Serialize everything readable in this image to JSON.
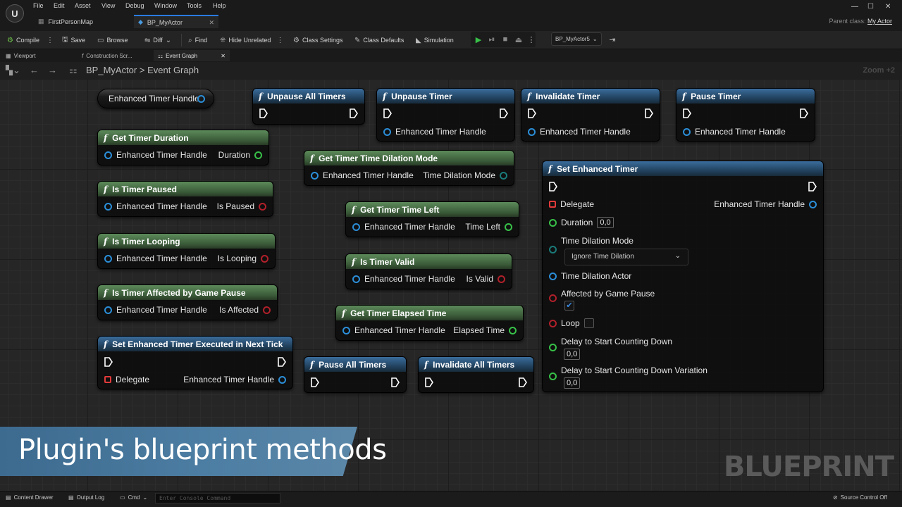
{
  "app": {
    "logo": "U",
    "menu": [
      "File",
      "Edit",
      "Asset",
      "View",
      "Debug",
      "Window",
      "Tools",
      "Help"
    ],
    "tabs": [
      {
        "label": "FirstPersonMap"
      },
      {
        "label": "BP_MyActor"
      }
    ],
    "window_controls": [
      "—",
      "☐",
      "✕"
    ],
    "parent_class_label": "Parent class:",
    "parent_class_value": "My Actor"
  },
  "toolbar": {
    "compile": "Compile",
    "save": "Save",
    "browse": "Browse",
    "diff": "Diff",
    "find": "Find",
    "hide_unrelated": "Hide Unrelated",
    "class_settings": "Class Settings",
    "class_defaults": "Class Defaults",
    "simulation": "Simulation",
    "debug_object": "BP_MyActor5"
  },
  "panel_tabs": [
    "Viewport",
    "Construction Scr...",
    "Event Graph"
  ],
  "breadcrumb": {
    "asset": "BP_MyActor",
    "separator": ">",
    "graph": "Event Graph"
  },
  "zoom": "Zoom +2",
  "nodes": {
    "var_handle": {
      "label": "Enhanced Timer Handle"
    },
    "unpause_all": {
      "title": "Unpause All Timers"
    },
    "unpause": {
      "title": "Unpause Timer",
      "in": "Enhanced Timer Handle"
    },
    "invalidate": {
      "title": "Invalidate Timer",
      "in": "Enhanced Timer Handle"
    },
    "pause": {
      "title": "Pause Timer",
      "in": "Enhanced Timer Handle"
    },
    "get_duration": {
      "title": "Get Timer Duration",
      "in": "Enhanced Timer Handle",
      "out": "Duration"
    },
    "get_dilation": {
      "title": "Get Timer Time Dilation Mode",
      "in": "Enhanced Timer Handle",
      "out": "Time Dilation Mode"
    },
    "is_paused": {
      "title": "Is Timer Paused",
      "in": "Enhanced Timer Handle",
      "out": "Is Paused"
    },
    "time_left": {
      "title": "Get Timer Time Left",
      "in": "Enhanced Timer Handle",
      "out": "Time Left"
    },
    "is_looping": {
      "title": "Is Timer Looping",
      "in": "Enhanced Timer Handle",
      "out": "Is Looping"
    },
    "is_valid": {
      "title": "Is Timer Valid",
      "in": "Enhanced Timer Handle",
      "out": "Is Valid"
    },
    "is_affected": {
      "title": "Is Timer Affected by Game Pause",
      "in": "Enhanced Timer Handle",
      "out": "Is Affected"
    },
    "elapsed": {
      "title": "Get Timer Elapsed Time",
      "in": "Enhanced Timer Handle",
      "out": "Elapsed Time"
    },
    "next_tick": {
      "title": "Set Enhanced Timer Executed in Next Tick",
      "in": "Delegate",
      "out": "Enhanced Timer Handle"
    },
    "pause_all": {
      "title": "Pause All Timers"
    },
    "invalidate_all": {
      "title": "Invalidate All Timers"
    },
    "set_timer": {
      "title": "Set Enhanced Timer",
      "delegate": "Delegate",
      "out": "Enhanced Timer Handle",
      "duration": "Duration",
      "duration_value": "0,0",
      "dilation_mode": "Time Dilation Mode",
      "dilation_value": "Ignore Time Dilation",
      "dilation_actor": "Time Dilation Actor",
      "affected": "Affected by Game Pause",
      "affected_checked": true,
      "loop": "Loop",
      "loop_checked": false,
      "delay": "Delay to Start Counting Down",
      "delay_value": "0,0",
      "delay_var": "Delay to Start Counting Down Variation",
      "delay_var_value": "0,0"
    }
  },
  "caption": "Plugin's blueprint methods",
  "watermark": "BLUEPRINT",
  "statusbar": {
    "content_drawer": "Content Drawer",
    "output_log": "Output Log",
    "cmd": "Cmd",
    "console_placeholder": "Enter Console Command",
    "source_control": "Source Control Off"
  },
  "colors": {
    "exec_white": "#ffffff",
    "handle_pin": "#2b8ed8",
    "float_pin": "#38c048",
    "bool_pin": "#b0202a",
    "delegate_pin": "#e03a3a",
    "func_header_blue": "#3a6d9c",
    "func_header_green": "#5c8a5a",
    "caption_bg": "#4d7ea3"
  }
}
